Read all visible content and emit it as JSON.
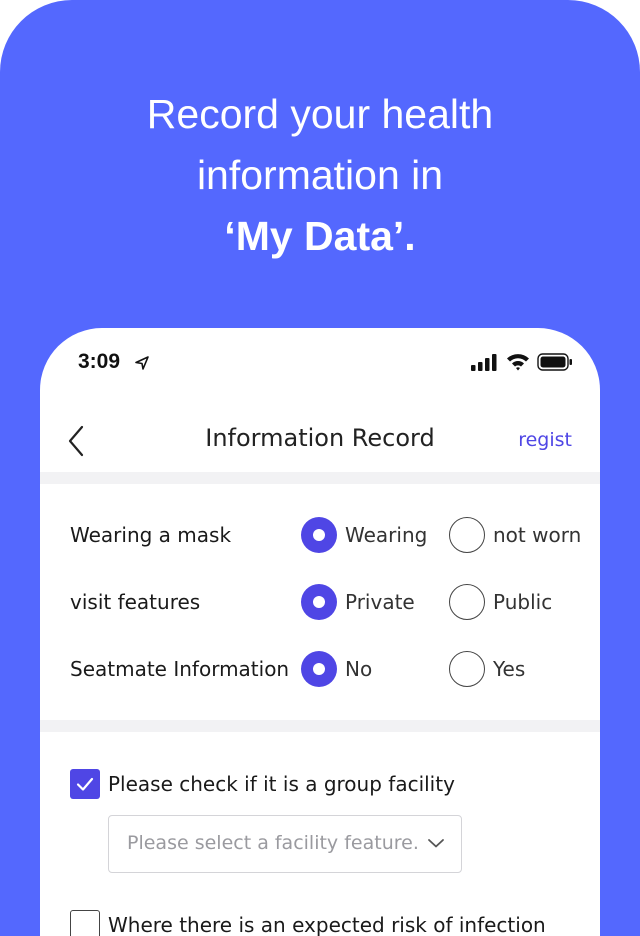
{
  "headline": {
    "line1": "Record your health",
    "line2": "information in",
    "line3": "‘My Data’."
  },
  "status_bar": {
    "time": "3:09",
    "icons": [
      "location-arrow-icon",
      "signal-icon",
      "wifi-icon",
      "battery-icon"
    ]
  },
  "nav": {
    "back_icon": "chevron-left-icon",
    "title": "Information Record",
    "action": "regist"
  },
  "questions": [
    {
      "label": "Wearing a mask",
      "options": [
        "Wearing",
        "not worn"
      ],
      "selected": 0
    },
    {
      "label": "visit features",
      "options": [
        "Private",
        "Public"
      ],
      "selected": 0
    },
    {
      "label": "Seatmate Information",
      "options": [
        "No",
        "Yes"
      ],
      "selected": 0
    }
  ],
  "group_facility": {
    "label": "Please check if it is a group facility",
    "checked": true,
    "select_placeholder": "Please select a facility feature."
  },
  "infection_risk": {
    "label": "Where there is an expected risk of infection",
    "checked": false
  },
  "colors": {
    "background": "#5468fe",
    "accent": "#4f46e5",
    "divider": "#f2f2f4"
  }
}
